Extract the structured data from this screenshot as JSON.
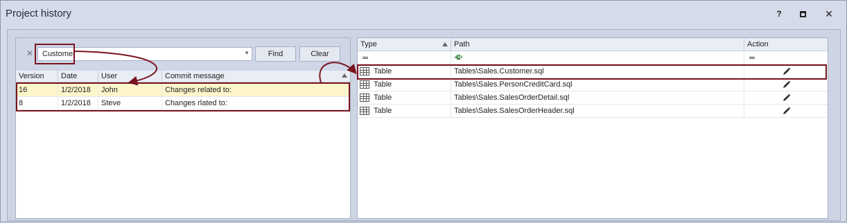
{
  "window": {
    "title": "Project history",
    "help": "?",
    "maximize_icon": "maximize-icon",
    "close": "✕"
  },
  "search": {
    "value": "Customer",
    "clear_icon": "✕",
    "dropdown_icon": "▼",
    "find_label": "Find",
    "clear_label": "Clear"
  },
  "commits": {
    "columns": [
      "Version",
      "Date",
      "User",
      "Commit message"
    ],
    "rows": [
      {
        "version": "16",
        "date": "1/2/2018",
        "user": "John",
        "message": "Changes related to:",
        "selected": true
      },
      {
        "version": "8",
        "date": "1/2/2018",
        "user": "Steve",
        "message": "Changes rlated to:",
        "selected": false
      }
    ]
  },
  "objects": {
    "columns": [
      "Type",
      "Path",
      "Action"
    ],
    "filter_icons": [
      "equals-icon",
      "abc-filter-icon",
      "equals-icon"
    ],
    "rows": [
      {
        "type": "Table",
        "path": "Tables\\Sales.Customer.sql",
        "action_icon": "pencil-icon",
        "selected": true
      },
      {
        "type": "Table",
        "path": "Tables\\Sales.PersonCreditCard.sql",
        "action_icon": "pencil-icon",
        "selected": false
      },
      {
        "type": "Table",
        "path": "Tables\\Sales.SalesOrderDetail.sql",
        "action_icon": "pencil-icon",
        "selected": false
      },
      {
        "type": "Table",
        "path": "Tables\\Sales.SalesOrderHeader.sql",
        "action_icon": "pencil-icon",
        "selected": false
      }
    ]
  },
  "colors": {
    "highlight_border": "#7a1420",
    "selected_row": "#fff6cc"
  }
}
